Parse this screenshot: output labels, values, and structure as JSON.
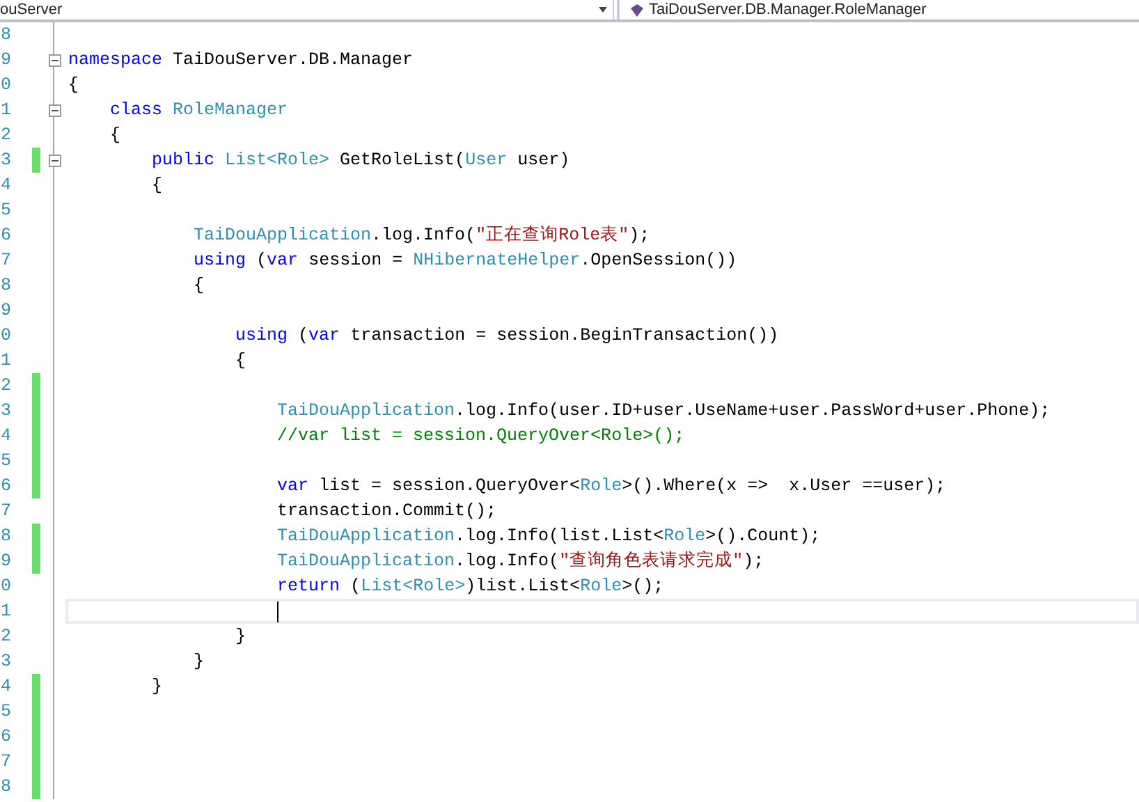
{
  "navigation_bar": {
    "project_dropdown": "ouServer",
    "class_dropdown": "TaiDouServer.DB.Manager.RoleManager"
  },
  "lines": [
    {
      "number": "8",
      "changed": false,
      "collapsible": false,
      "current": false
    },
    {
      "number": "9",
      "changed": false,
      "collapsible": true,
      "current": false,
      "tokens": [
        {
          "kind": "keyword",
          "text": "namespace"
        },
        {
          "kind": "plain",
          "text": " TaiDouServer.DB.Manager"
        }
      ]
    },
    {
      "number": "0",
      "changed": false,
      "collapsible": false,
      "current": false,
      "tokens": [
        {
          "kind": "plain",
          "text": "{"
        }
      ]
    },
    {
      "number": "1",
      "changed": false,
      "collapsible": true,
      "current": false,
      "tokens": [
        {
          "kind": "keyword",
          "text": "    class "
        },
        {
          "kind": "type",
          "text": "RoleManager"
        }
      ]
    },
    {
      "number": "2",
      "changed": false,
      "collapsible": false,
      "current": false,
      "tokens": [
        {
          "kind": "plain",
          "text": "    {"
        }
      ]
    },
    {
      "number": "3",
      "changed": true,
      "collapsible": true,
      "current": false,
      "tokens": [
        {
          "kind": "keyword",
          "text": "        public "
        },
        {
          "kind": "type",
          "text": "List<Role>"
        },
        {
          "kind": "plain",
          "text": " GetRoleList("
        },
        {
          "kind": "type",
          "text": "User"
        },
        {
          "kind": "plain",
          "text": " user)"
        }
      ]
    },
    {
      "number": "4",
      "changed": false,
      "collapsible": false,
      "current": false,
      "tokens": [
        {
          "kind": "plain",
          "text": "        {"
        }
      ]
    },
    {
      "number": "5",
      "changed": false,
      "collapsible": false,
      "current": false
    },
    {
      "number": "6",
      "changed": false,
      "collapsible": false,
      "current": false,
      "tokens": [
        {
          "kind": "type",
          "text": "            TaiDouApplication"
        },
        {
          "kind": "plain",
          "text": ".log.Info("
        },
        {
          "kind": "string",
          "text": "\"正在查询Role表\""
        },
        {
          "kind": "plain",
          "text": ");"
        }
      ]
    },
    {
      "number": "7",
      "changed": false,
      "collapsible": false,
      "current": false,
      "tokens": [
        {
          "kind": "keyword",
          "text": "            using"
        },
        {
          "kind": "plain",
          "text": " ("
        },
        {
          "kind": "keyword",
          "text": "var"
        },
        {
          "kind": "plain",
          "text": " session = "
        },
        {
          "kind": "type",
          "text": "NHibernateHelper"
        },
        {
          "kind": "plain",
          "text": ".OpenSession())"
        }
      ]
    },
    {
      "number": "8",
      "changed": false,
      "collapsible": false,
      "current": false,
      "tokens": [
        {
          "kind": "plain",
          "text": "            {"
        }
      ]
    },
    {
      "number": "9",
      "changed": false,
      "collapsible": false,
      "current": false
    },
    {
      "number": "0",
      "changed": false,
      "collapsible": false,
      "current": false,
      "tokens": [
        {
          "kind": "keyword",
          "text": "                using"
        },
        {
          "kind": "plain",
          "text": " ("
        },
        {
          "kind": "keyword",
          "text": "var"
        },
        {
          "kind": "plain",
          "text": " transaction = session.BeginTransaction())"
        }
      ]
    },
    {
      "number": "1",
      "changed": false,
      "collapsible": false,
      "current": false,
      "tokens": [
        {
          "kind": "plain",
          "text": "                {"
        }
      ]
    },
    {
      "number": "2",
      "changed": true,
      "collapsible": false,
      "current": false
    },
    {
      "number": "3",
      "changed": true,
      "collapsible": false,
      "current": false,
      "tokens": [
        {
          "kind": "type",
          "text": "                    TaiDouApplication"
        },
        {
          "kind": "plain",
          "text": ".log.Info(user.ID+user.UseName+user.PassWord+user.Phone);"
        }
      ]
    },
    {
      "number": "4",
      "changed": true,
      "collapsible": false,
      "current": false,
      "tokens": [
        {
          "kind": "comment",
          "text": "                    //var list = session.QueryOver<Role>();"
        }
      ]
    },
    {
      "number": "5",
      "changed": true,
      "collapsible": false,
      "current": false
    },
    {
      "number": "6",
      "changed": true,
      "collapsible": false,
      "current": false,
      "tokens": [
        {
          "kind": "keyword",
          "text": "                    var"
        },
        {
          "kind": "plain",
          "text": " list = session.QueryOver<"
        },
        {
          "kind": "type",
          "text": "Role"
        },
        {
          "kind": "plain",
          "text": ">().Where(x =>  x.User ==user);"
        }
      ]
    },
    {
      "number": "7",
      "changed": false,
      "collapsible": false,
      "current": false,
      "tokens": [
        {
          "kind": "plain",
          "text": "                    transaction.Commit();"
        }
      ]
    },
    {
      "number": "8",
      "changed": true,
      "collapsible": false,
      "current": false,
      "tokens": [
        {
          "kind": "type",
          "text": "                    TaiDouApplication"
        },
        {
          "kind": "plain",
          "text": ".log.Info(list.List<"
        },
        {
          "kind": "type",
          "text": "Role"
        },
        {
          "kind": "plain",
          "text": ">().Count);"
        }
      ]
    },
    {
      "number": "9",
      "changed": true,
      "collapsible": false,
      "current": false,
      "tokens": [
        {
          "kind": "type",
          "text": "                    TaiDouApplication"
        },
        {
          "kind": "plain",
          "text": ".log.Info("
        },
        {
          "kind": "string",
          "text": "\"查询角色表请求完成\""
        },
        {
          "kind": "plain",
          "text": ");"
        }
      ]
    },
    {
      "number": "0",
      "changed": false,
      "collapsible": false,
      "current": false,
      "tokens": [
        {
          "kind": "keyword",
          "text": "                    return"
        },
        {
          "kind": "plain",
          "text": " ("
        },
        {
          "kind": "type",
          "text": "List<Role>"
        },
        {
          "kind": "plain",
          "text": ")list.List<"
        },
        {
          "kind": "type",
          "text": "Role"
        },
        {
          "kind": "plain",
          "text": ">();"
        }
      ]
    },
    {
      "number": "1",
      "changed": false,
      "collapsible": false,
      "current": true
    },
    {
      "number": "2",
      "changed": false,
      "collapsible": false,
      "current": false,
      "tokens": [
        {
          "kind": "plain",
          "text": "                }"
        }
      ]
    },
    {
      "number": "3",
      "changed": false,
      "collapsible": false,
      "current": false,
      "tokens": [
        {
          "kind": "plain",
          "text": "            }"
        }
      ]
    },
    {
      "number": "4",
      "changed": true,
      "collapsible": false,
      "current": false,
      "tokens": [
        {
          "kind": "plain",
          "text": "        }"
        }
      ]
    },
    {
      "number": "5",
      "changed": true,
      "collapsible": false,
      "current": false
    },
    {
      "number": "6",
      "changed": true,
      "collapsible": false,
      "current": false
    },
    {
      "number": "7",
      "changed": true,
      "collapsible": false,
      "current": false
    },
    {
      "number": "8",
      "changed": true,
      "collapsible": false,
      "current": false
    }
  ]
}
